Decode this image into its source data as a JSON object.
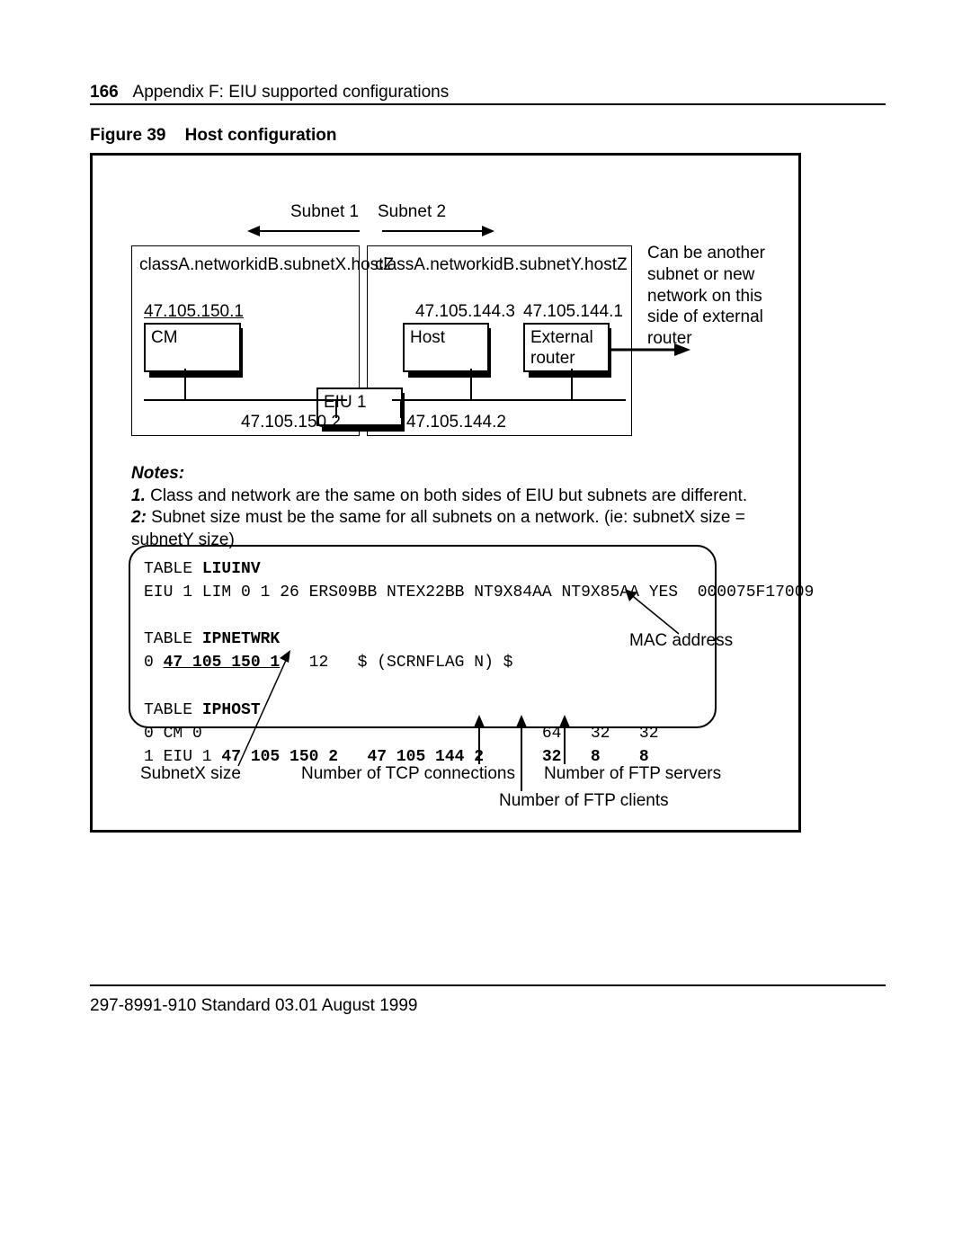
{
  "header": {
    "page_number": "166",
    "title": "Appendix F: EIU supported configurations"
  },
  "figure": {
    "label": "Figure 39",
    "title": "Host configuration"
  },
  "diagram": {
    "subnet1_label": "Subnet 1",
    "subnet2_label": "Subnet 2",
    "subnet1_caption": "classA.networkidB.subnetX.hostZ",
    "subnet2_caption": "classA.networkidB.subnetY.hostZ",
    "cm_ip": "47.105.150.1",
    "cm_label": "CM",
    "host_ip": "47.105.144.3",
    "host_label": "Host",
    "ext_router_ip": "47.105.144.1",
    "ext_router_label": "External router",
    "eiu_label": "EIU 1",
    "eiu_left_ip": "47.105.150.2",
    "eiu_right_ip": "47.105.144.2",
    "side_note": "Can be another subnet or new network on this side of external router"
  },
  "notes": {
    "heading": "Notes:",
    "n1_label": "1.",
    "n1_text": " Class and network are the same on both sides of EIU but subnets are different.",
    "n2_label": "2:",
    "n2_text": " Subnet size must be the same for all subnets on a network. (ie: subnetX size = subnetY size)"
  },
  "terminal": {
    "l1a": "TABLE ",
    "l1b": "LIUINV",
    "l2": "EIU 1 LIM 0 1 26 ERS09BB NTEX22BB NT9X84AA NT9X85AA YES  000075F17009",
    "l3a": "TABLE ",
    "l3b": "IPNETWRK",
    "l4a": "0 ",
    "l4b": "47 105 150 1",
    "l4c": "   12   $ (SCRNFLAG N) $",
    "l5a": "TABLE ",
    "l5b": "IPHOST",
    "l6": "0 CM 0                                   64   32   32",
    "l7a": "1 EIU 1 ",
    "l7b": "47 105 150 2   47 105 144 2      32   8    8"
  },
  "callouts": {
    "mac": "MAC address",
    "subnetx": "SubnetX size",
    "tcp": "Number of TCP connections",
    "ftp_clients": "Number of FTP clients",
    "ftp_servers": "Number of FTP servers"
  },
  "footer": {
    "text": "297-8991-910  Standard  03.01  August 1999"
  }
}
